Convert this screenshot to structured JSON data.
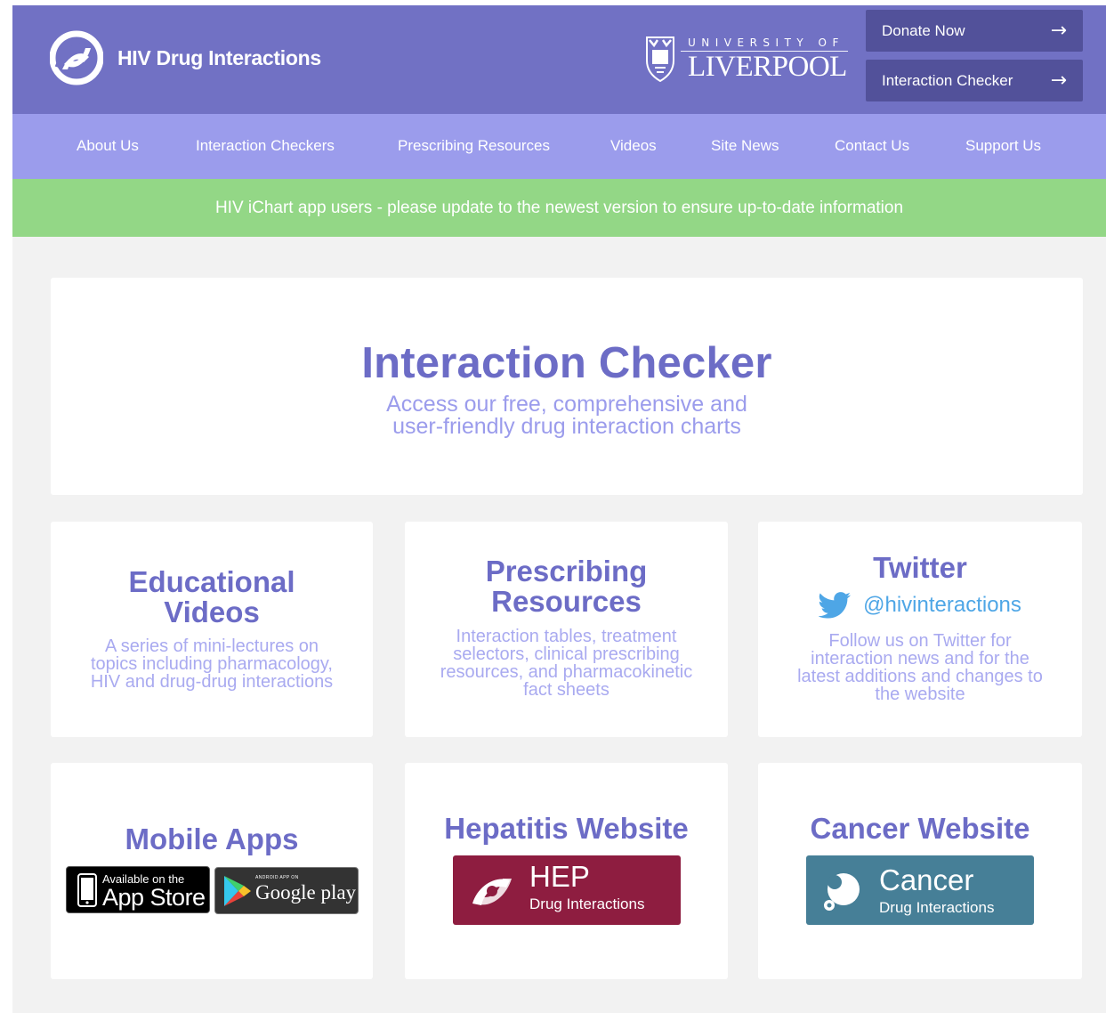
{
  "header": {
    "brand_name": "HIV Drug Interactions",
    "university_top": "UNIVERSITY OF",
    "university_name": "LIVERPOOL",
    "donate_label": "Donate Now",
    "checker_label": "Interaction Checker",
    "arrow_glyph": "→"
  },
  "nav": {
    "items": [
      {
        "label": "About Us"
      },
      {
        "label": "Interaction Checkers"
      },
      {
        "label": "Prescribing Resources"
      },
      {
        "label": "Videos"
      },
      {
        "label": "Site News"
      },
      {
        "label": "Contact Us"
      },
      {
        "label": "Support Us"
      }
    ]
  },
  "alert": {
    "text": "HIV iChart app users - please update to the newest version to ensure up-to-date information"
  },
  "hero": {
    "title": "Interaction Checker",
    "subtitle_line1": "Access our free, comprehensive and",
    "subtitle_line2": "user-friendly drug interaction charts"
  },
  "cards": {
    "edu": {
      "title_line1": "Educational",
      "title_line2": "Videos",
      "desc_line1": "A series of mini-lectures on",
      "desc_line2": "topics including pharmacology,",
      "desc_line3": "HIV and drug-drug interactions"
    },
    "presc": {
      "title_line1": "Prescribing",
      "title_line2": "Resources",
      "desc_line1": "Interaction tables, treatment",
      "desc_line2": "selectors, clinical prescribing",
      "desc_line3": "resources, and pharmacokinetic",
      "desc_line4": "fact sheets"
    },
    "twitter": {
      "title": "Twitter",
      "handle": "@hivinteractions",
      "desc_line1": "Follow us on Twitter for",
      "desc_line2": "interaction news and for the",
      "desc_line3": "latest additions and changes to",
      "desc_line4": "the website"
    },
    "mobile": {
      "title": "Mobile Apps",
      "appstore_small": "Available on the",
      "appstore_big": "App Store",
      "gplay_small": "ANDROID APP ON",
      "gplay_big": "Google play"
    },
    "hep": {
      "title": "Hepatitis Website",
      "badge_big": "HEP",
      "badge_small": "Drug Interactions"
    },
    "cancer": {
      "title": "Cancer Website",
      "badge_big": "Cancer",
      "badge_small": "Drug Interactions"
    }
  },
  "colors": {
    "header_bg": "#7171c4",
    "nav_bg": "#9b9cec",
    "alert_bg": "#93d786",
    "button_bg": "#52519a",
    "title_color": "#6c6cc6",
    "desc_color": "#a9aaf0",
    "twitter_blue": "#4ea6e6",
    "hep_bg": "#8e1d40",
    "cancer_bg": "#467f97"
  },
  "icons": [
    "hiv-logo-icon",
    "liverpool-crest-icon",
    "arrow-right-icon",
    "twitter-bird-icon",
    "apple-phone-icon",
    "google-play-icon",
    "hep-logo-icon",
    "cancer-logo-icon"
  ]
}
